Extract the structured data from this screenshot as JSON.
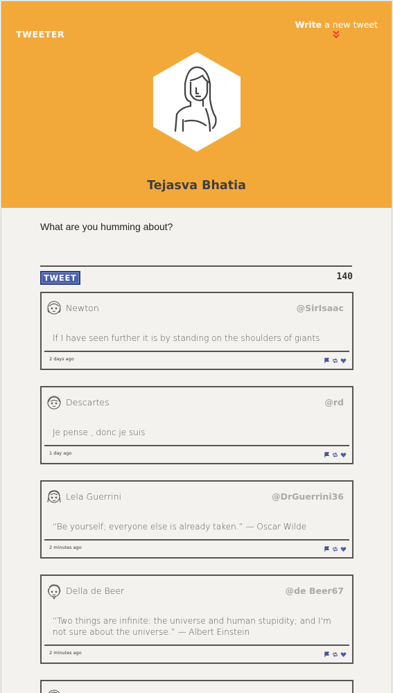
{
  "brand": {
    "logo": "TWEETER",
    "accent": "#f3a93a",
    "button_color": "#4a5fa8"
  },
  "nav": {
    "compose_strong": "Write",
    "compose_rest": " a new tweet"
  },
  "profile": {
    "name": "Tejasva Bhatia"
  },
  "composer": {
    "prompt": "What are you humming about?",
    "input_value": "",
    "button_label": "TWEET",
    "counter": "140"
  },
  "tweets": [
    {
      "author": "Newton",
      "handle": "@SirIsaac",
      "text": "If I have seen further it is by standing on the shoulders of giants",
      "time": "2 days ago"
    },
    {
      "author": "Descartes",
      "handle": "@rd",
      "text": "Je pense , donc je suis",
      "time": "1 day ago"
    },
    {
      "author": "Lela Guerrini",
      "handle": "@DrGuerrini36",
      "text": "“Be yourself; everyone else is already taken.” — Oscar Wilde",
      "time": "2 minutes ago"
    },
    {
      "author": "Della de Beer",
      "handle": "@de Beer67",
      "text": "“Two things are infinite: the universe and human stupidity; and I'm not sure about the universe.” — Albert Einstein",
      "time": "2 minutes ago"
    }
  ]
}
